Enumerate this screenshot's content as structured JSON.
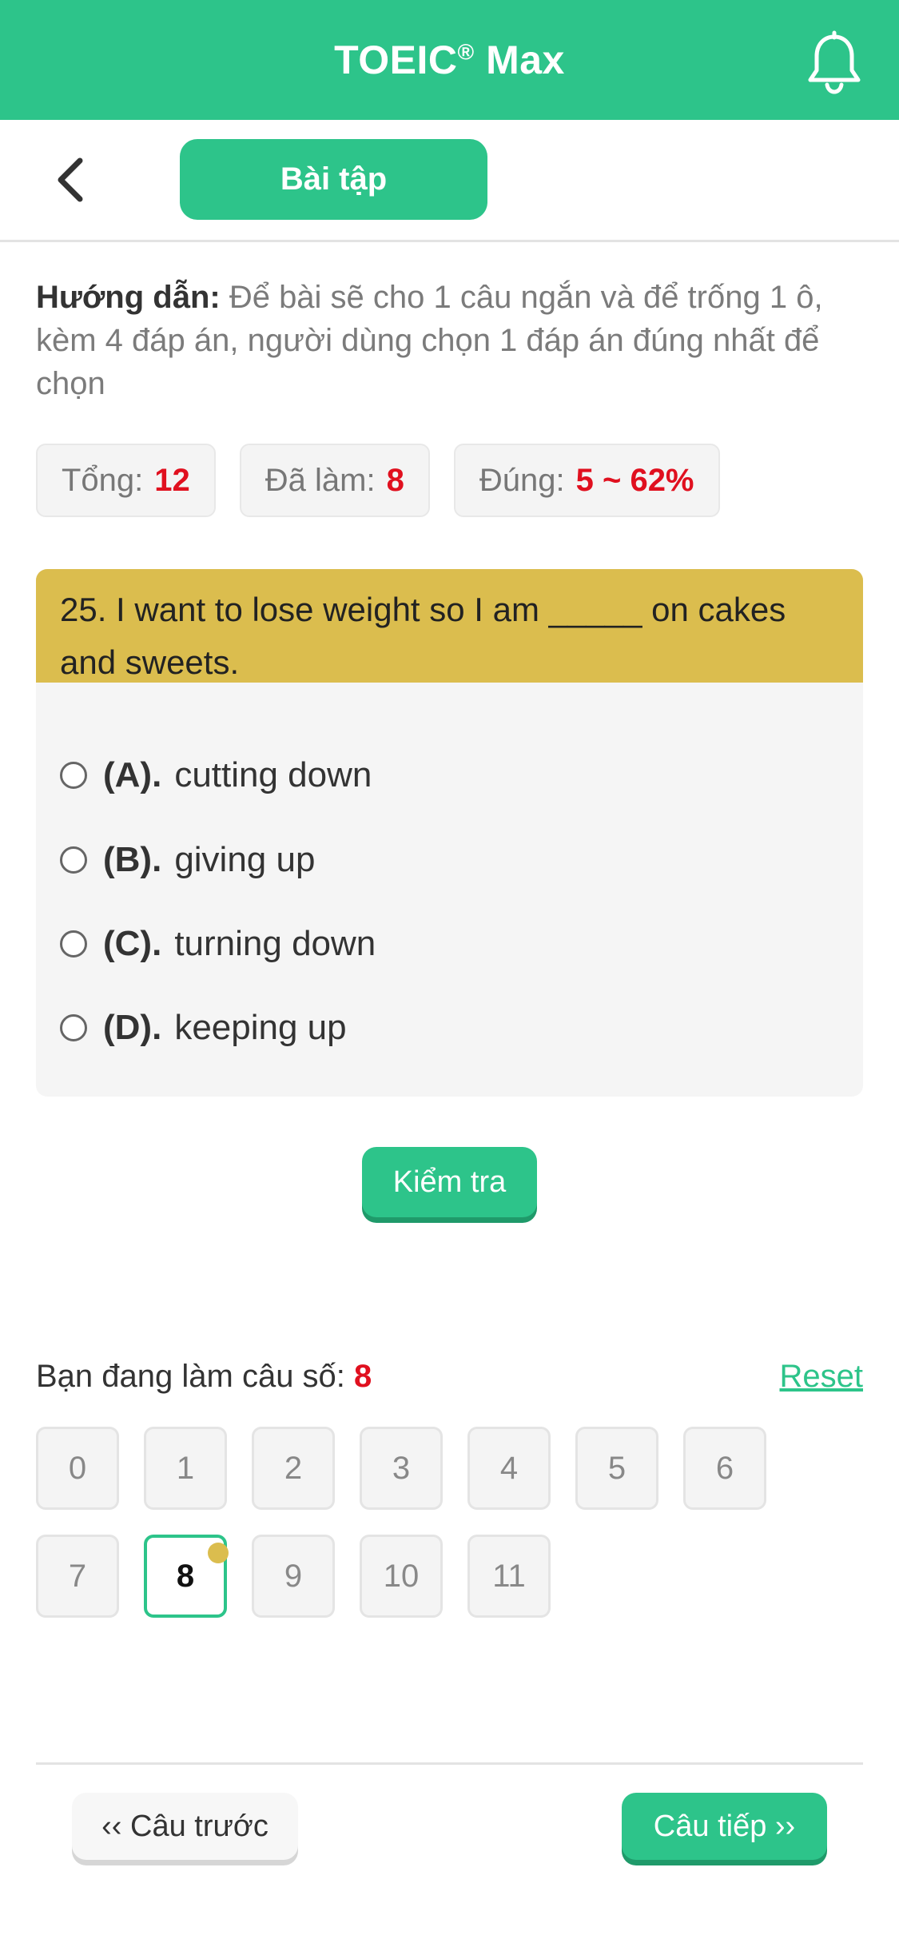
{
  "header": {
    "title": "TOEIC",
    "title_mark": "®",
    "title_suffix": " Max"
  },
  "nav": {
    "tab_label": "Bài tập"
  },
  "instructions": {
    "label": "Hướng dẫn:",
    "text": " Để bài sẽ cho 1 câu ngắn và để trống 1 ô, kèm 4 đáp án, người dùng chọn 1 đáp án đúng nhất để chọn"
  },
  "stats": [
    {
      "label": "Tổng:",
      "value": "12"
    },
    {
      "label": "Đã làm:",
      "value": "8"
    },
    {
      "label": "Đúng:",
      "value": "5 ~ 62%"
    }
  ],
  "question": {
    "text": "25. I want to lose weight so I am _____ on cakes and sweets.",
    "options": [
      {
        "label": "(A).",
        "text": "cutting down"
      },
      {
        "label": "(B).",
        "text": "giving up"
      },
      {
        "label": "(C).",
        "text": "turning down"
      },
      {
        "label": "(D).",
        "text": "keeping up"
      }
    ]
  },
  "check_button": "Kiểm tra",
  "progress": {
    "label": "Bạn đang làm câu số:",
    "current": "8",
    "reset": "Reset"
  },
  "numbers": [
    "0",
    "1",
    "2",
    "3",
    "4",
    "5",
    "6",
    "7",
    "8",
    "9",
    "10",
    "11"
  ],
  "footer": {
    "prev": "‹‹ Câu trước",
    "next": "Câu tiếp ››"
  },
  "colors": {
    "brand": "#2dc48a",
    "question_bg": "#dbbd4e",
    "highlight": "#e0101f"
  }
}
